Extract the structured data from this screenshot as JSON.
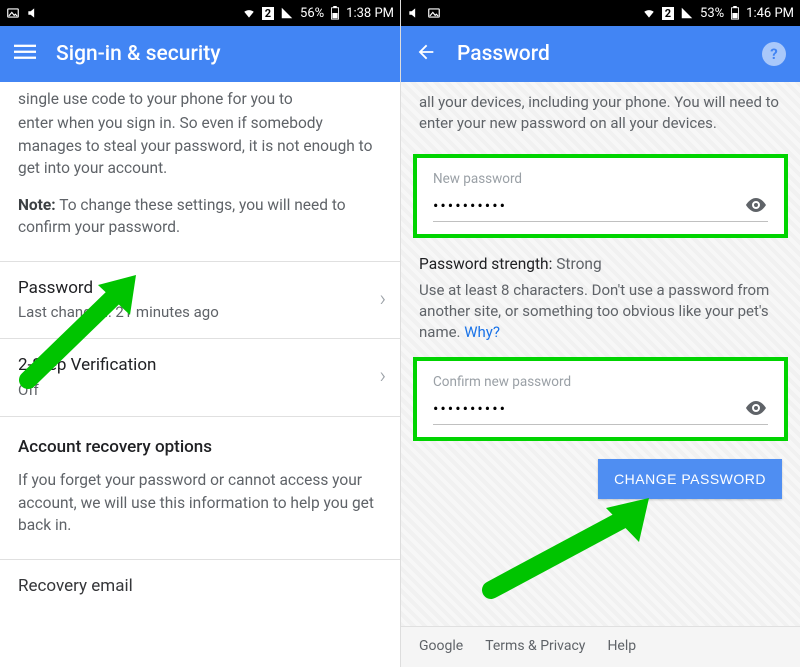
{
  "left": {
    "statusbar": {
      "battery": "56%",
      "time": "1:38 PM",
      "sim": "2"
    },
    "appbar": {
      "title": "Sign-in & security"
    },
    "intro": "enter when you sign in. So even if somebody manages to steal your password, it is not enough to get into your account.",
    "note_label": "Note:",
    "note_text": " To change these settings, you will need to confirm your password.",
    "items": [
      {
        "title": "Password",
        "sub": "Last changed: 21 minutes ago"
      },
      {
        "title": "2-Step Verification",
        "sub": "Off"
      }
    ],
    "recovery_header": "Account recovery options",
    "recovery_text": "If you forget your password or cannot access your account, we will use this information to help you get back in.",
    "recovery_item": "Recovery email"
  },
  "right": {
    "statusbar": {
      "battery": "53%",
      "time": "1:46 PM",
      "sim": "2"
    },
    "appbar": {
      "title": "Password"
    },
    "intro": "all your devices, including your phone. You will need to enter your new password on all your devices.",
    "new_label": "New password",
    "new_value": "••••••••••",
    "strength_label": "Password strength:",
    "strength_value": " Strong",
    "guidance": "Use at least 8 characters. Don't use a password from another site, or something too obvious like your pet's name. ",
    "why": "Why?",
    "confirm_label": "Confirm new password",
    "confirm_value": "••••••••••",
    "button": "CHANGE PASSWORD",
    "footer": {
      "google": "Google",
      "terms": "Terms & Privacy",
      "help": "Help"
    }
  }
}
